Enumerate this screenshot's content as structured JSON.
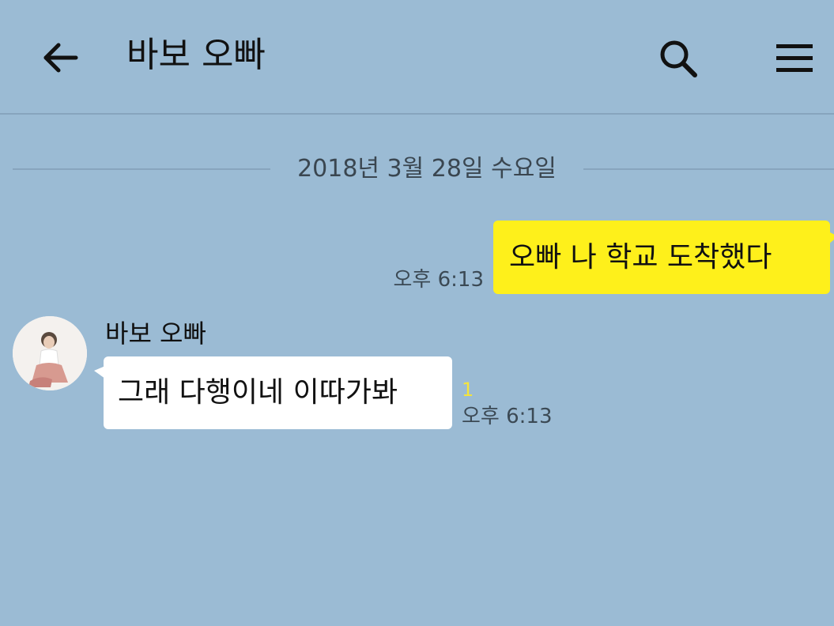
{
  "header": {
    "title": "바보 오빠",
    "back_icon": "arrow-left-icon",
    "search_icon": "search-icon",
    "menu_icon": "hamburger-menu-icon"
  },
  "date_divider": "2018년 3월 28일 수요일",
  "messages": [
    {
      "direction": "outgoing",
      "text": "오빠 나 학교 도착했다",
      "time": "오후 6:13"
    },
    {
      "direction": "incoming",
      "sender": "바보 오빠",
      "text": "그래 다행이네 이따가봐",
      "unread_count": "1",
      "time": "오후 6:13"
    }
  ],
  "colors": {
    "background": "#9bbbd4",
    "outgoing_bubble": "#fef01b",
    "incoming_bubble": "#ffffff",
    "unread_count": "#f5e43a"
  }
}
